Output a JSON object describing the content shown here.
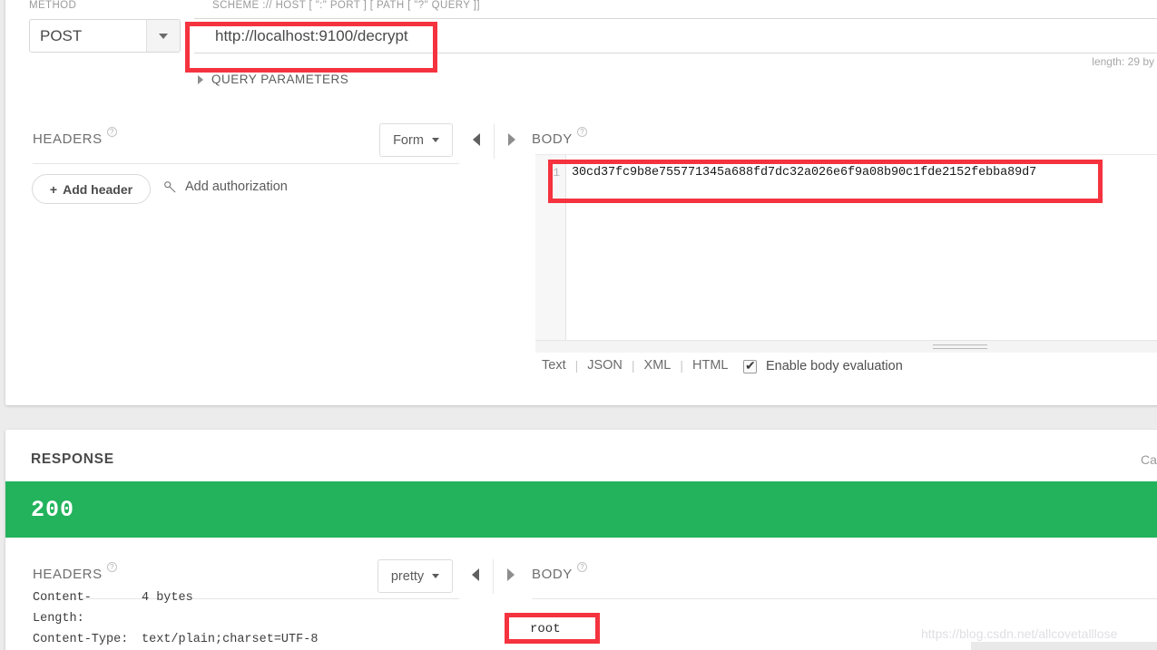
{
  "request": {
    "method_label": "METHOD",
    "method_value": "POST",
    "url_label": "SCHEME :// HOST [ \":\" PORT ] [ PATH [ \"?\" QUERY ]]",
    "url_value": "http://localhost:9100/decrypt",
    "length_text": "length: 29 by",
    "query_parameters_label": "QUERY PARAMETERS",
    "headers": {
      "title": "HEADERS",
      "help_icon": "question-mark-icon",
      "format_value": "Form",
      "add_header_label": "Add header",
      "add_header_plus": "+",
      "add_authorization_label": "Add authorization",
      "key_icon": "key-icon"
    },
    "body": {
      "title": "BODY",
      "help_icon": "question-mark-icon",
      "line_numbers": [
        "1"
      ],
      "content": "30cd37fc9b8e755771345a688fd7dc32a026e6f9a08b90c1fde2152febba89d7",
      "formats": [
        "Text",
        "JSON",
        "XML",
        "HTML"
      ],
      "format_separator": "|",
      "eval_label": "Enable body evaluation",
      "eval_checked": true
    },
    "collapse_left_icon": "triangle-left-icon",
    "collapse_right_icon": "triangle-right-icon"
  },
  "response": {
    "title": "RESPONSE",
    "right_text": "Ca",
    "status_code": "200",
    "status_color": "#22b35c",
    "headers": {
      "title": "HEADERS",
      "help_icon": "question-mark-icon",
      "format_value": "pretty",
      "rows": [
        {
          "key": "Content-Length:",
          "value": "4 bytes"
        },
        {
          "key": "Content-Type:",
          "value": "text/plain;charset=UTF-8"
        }
      ]
    },
    "body": {
      "title": "BODY",
      "help_icon": "question-mark-icon",
      "value": "root"
    }
  },
  "annotations": {
    "color": "#f5333f",
    "boxes": [
      "url-field",
      "request-body-line",
      "response-body-value"
    ]
  },
  "watermark": {
    "text": "https://blog.csdn.net/allcovetalllose"
  }
}
